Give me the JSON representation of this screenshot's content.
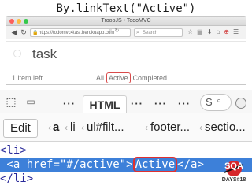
{
  "caption": "By.linkText(\"Active\")",
  "browser": {
    "window_title": "TroopJS • TodoMVC",
    "url": "https://todomvc4tasj.herokuapp.com",
    "search_placeholder": "Search"
  },
  "todo": {
    "task_title": "task",
    "items_left": "1 item left",
    "filters": [
      "All",
      "Active",
      "Completed"
    ],
    "active_filter": "Active"
  },
  "devtools": {
    "selected_tab": "HTML",
    "breadcrumbs": [
      "Edit",
      "a",
      "li",
      "ul#filt...",
      "footer...",
      "sectio..."
    ],
    "search_letter": "S"
  },
  "code": {
    "line1": "<li>",
    "line2_open": "<a href=\"#/active\">",
    "line2_text": "Active",
    "line2_close": "</a>",
    "line3": "</li>"
  },
  "logo": {
    "name": "SQA",
    "sub": "DAYS#18"
  },
  "colors": {
    "highlight": "#3d80d9",
    "marker": "#d94a4a",
    "code_tag": "#2a2a9a"
  }
}
